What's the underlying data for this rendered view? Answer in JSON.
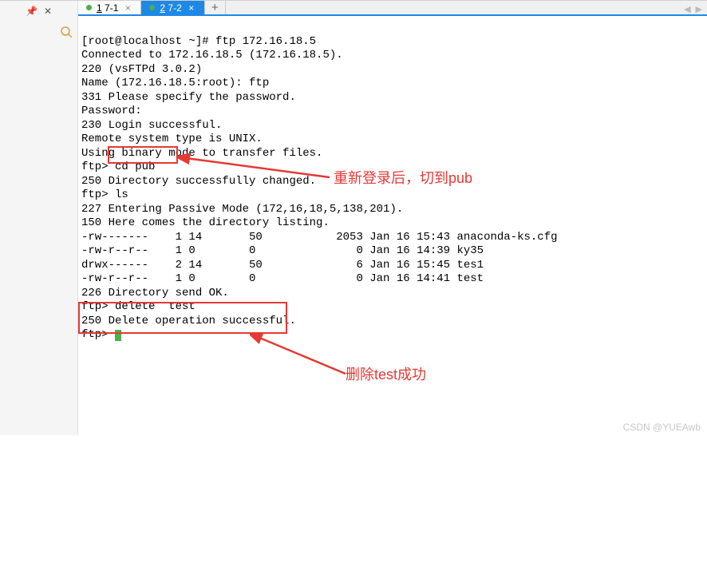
{
  "gutter": {
    "pin": "📌",
    "close_tabs": "✕"
  },
  "search_icon_alt": "search",
  "tabs": [
    {
      "dot": true,
      "num": "1",
      "label": "7-1",
      "active": false
    },
    {
      "dot": true,
      "num": "2",
      "label": "7-2",
      "active": true
    }
  ],
  "terminal": [
    "[root@localhost ~]# ftp 172.16.18.5",
    "Connected to 172.16.18.5 (172.16.18.5).",
    "220 (vsFTPd 3.0.2)",
    "Name (172.16.18.5:root): ftp",
    "331 Please specify the password.",
    "Password:",
    "230 Login successful.",
    "Remote system type is UNIX.",
    "Using binary mode to transfer files.",
    "ftp> cd pub",
    "250 Directory successfully changed.",
    "ftp> ls",
    "227 Entering Passive Mode (172,16,18,5,138,201).",
    "150 Here comes the directory listing.",
    "-rw-------    1 14       50           2053 Jan 16 15:43 anaconda-ks.cfg",
    "-rw-r--r--    1 0        0               0 Jan 16 14:39 ky35",
    "drwx------    2 14       50              6 Jan 16 15:45 tes1",
    "-rw-r--r--    1 0        0               0 Jan 16 14:41 test",
    "226 Directory send OK.",
    "ftp> delete  test",
    "250 Delete operation successful.",
    "ftp> "
  ],
  "annotations": {
    "relogin_pub": "重新登录后，切到pub",
    "delete_success": "删除test成功"
  },
  "watermark": "CSDN @YUEAwb",
  "colors": {
    "highlight": "#e53935",
    "tab_active": "#1e88e5",
    "cursor": "#4caf50"
  }
}
